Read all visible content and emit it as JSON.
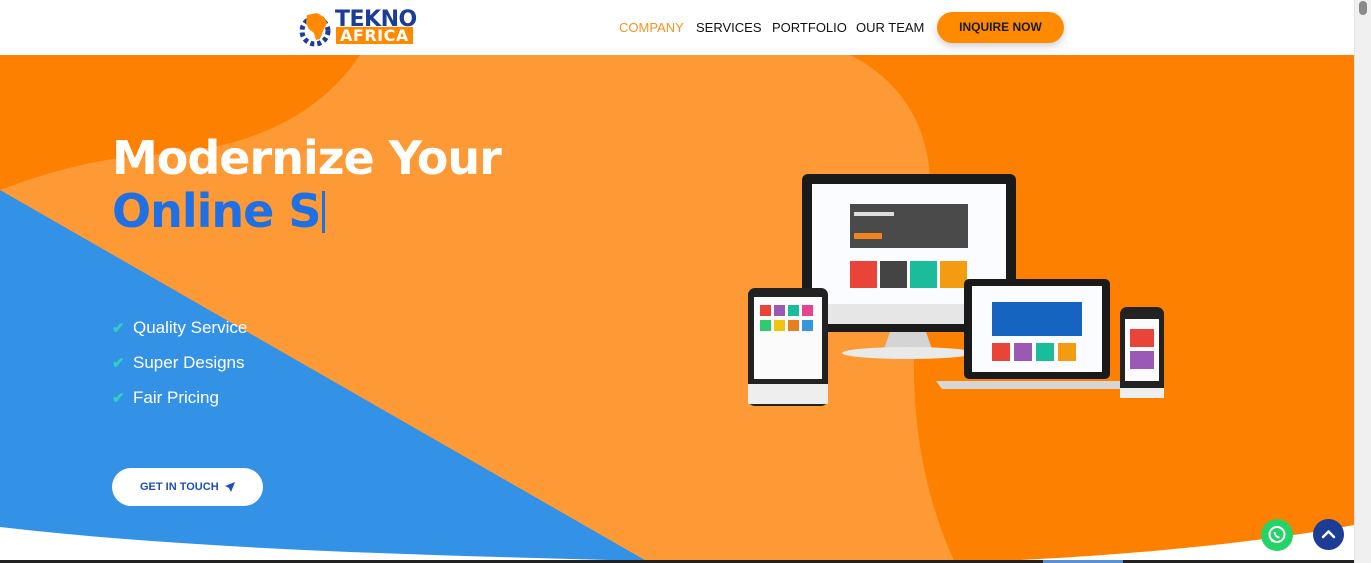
{
  "brand": {
    "logo_top": "TEKNO",
    "logo_bottom": "AFRICA",
    "colors": {
      "orange": "#fd8000",
      "light_orange": "#fe9a35",
      "blue": "#3492e6",
      "navy": "#1b3d95",
      "accent_blue": "#1f6fe5"
    }
  },
  "nav": {
    "items": [
      {
        "label": "COMPANY",
        "active": true
      },
      {
        "label": "SERVICES",
        "active": false
      },
      {
        "label": "PORTFOLIO",
        "active": false
      },
      {
        "label": "OUR TEAM",
        "active": false
      }
    ],
    "cta_label": "INQUIRE NOW"
  },
  "hero": {
    "headline_line1": "Modernize Your",
    "headline_line2": "Online S",
    "features": [
      "Quality Service",
      "Super Designs",
      "Fair Pricing"
    ],
    "cta_label": "GET IN TOUCH",
    "cta_icon": "paper-plane-icon",
    "illustration": "responsive-devices-mockup"
  },
  "floating": {
    "whatsapp_icon": "whatsapp-icon",
    "scroll_top_icon": "chevron-up-icon"
  }
}
